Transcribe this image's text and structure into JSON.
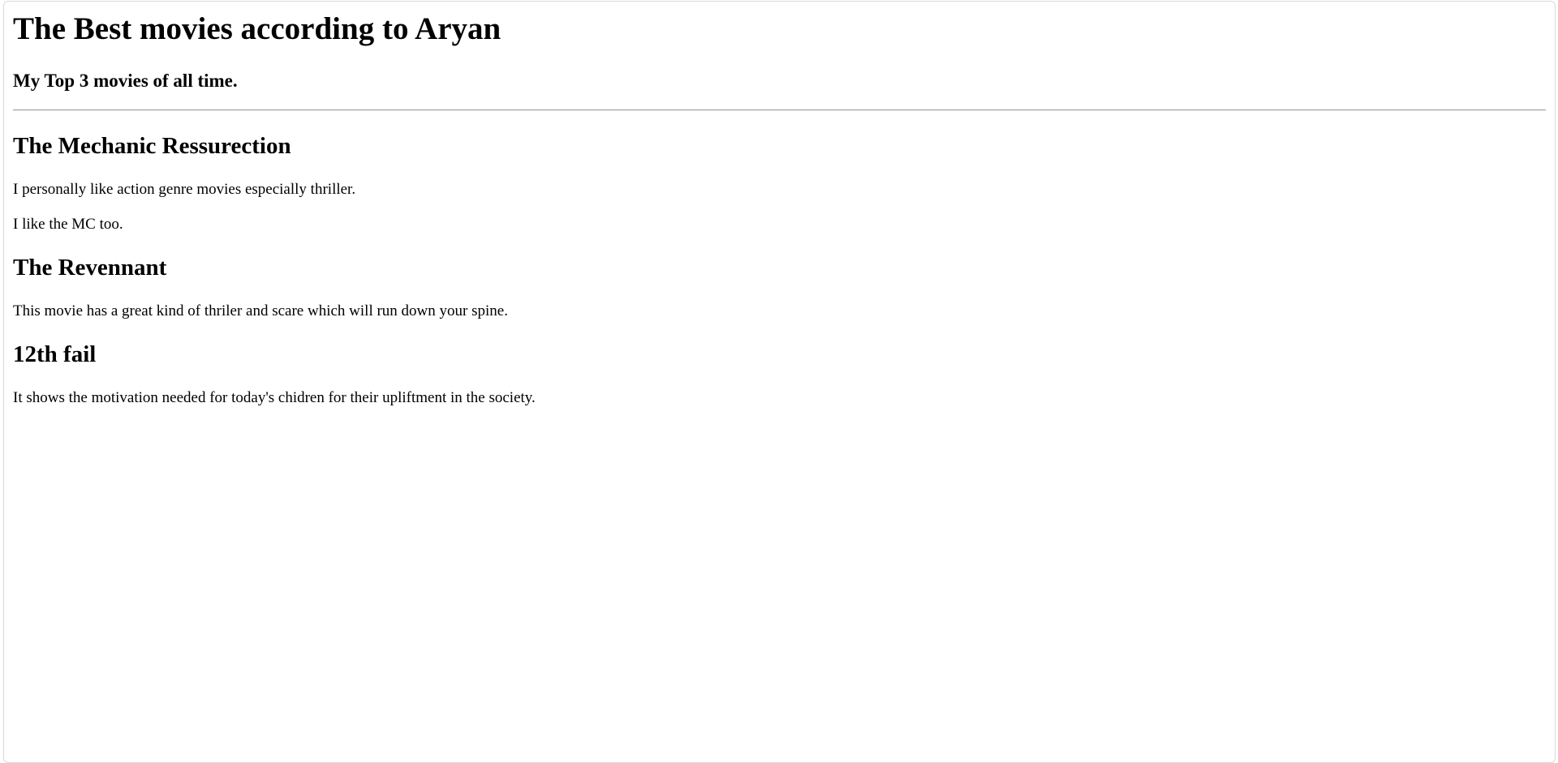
{
  "page": {
    "title": "The Best movies according to Aryan",
    "subtitle": "My Top 3 movies of all time."
  },
  "movies": [
    {
      "title": "The Mechanic Ressurection",
      "paragraphs": [
        "I personally like action genre movies especially thriller.",
        "I like the MC too."
      ]
    },
    {
      "title": "The Revennant",
      "paragraphs": [
        "This movie has a great kind of thriler and scare which will run down your spine."
      ]
    },
    {
      "title": "12th fail",
      "paragraphs": [
        "It shows the motivation needed for today's chidren for their upliftment in the society."
      ]
    }
  ]
}
